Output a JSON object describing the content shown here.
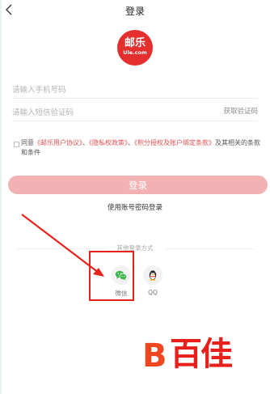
{
  "header": {
    "title": "登录"
  },
  "logo": {
    "main": "邮乐",
    "sub": "Ule.com"
  },
  "form": {
    "phone_placeholder": "请输入手机号码",
    "code_placeholder": "请输入短信验证码",
    "get_code_label": "获取验证码"
  },
  "agreement": {
    "prefix": "同意",
    "link1": "《邮乐用户协议》",
    "sep1": "、",
    "link2": "《隐私权政策》",
    "sep2": "、",
    "link3": "《积分授权及账户绑定条款》",
    "suffix": "及其相关的条款和条件"
  },
  "login_button_label": "登录",
  "password_login_label": "使用账号密码登录",
  "other_login": {
    "label": "其他登录方式",
    "wechat_label": "微信",
    "qq_label": "QQ"
  },
  "watermark": {
    "mark": "B",
    "text": "百佳"
  },
  "colors": {
    "brand_red": "#e52e2e",
    "login_button": "#f2b1b3",
    "link": "#e0504f",
    "wechat_green": "#3bb54a",
    "annotation_red": "#e5231b"
  },
  "icons": [
    "back-arrow-icon",
    "wechat-icon",
    "qq-icon"
  ]
}
